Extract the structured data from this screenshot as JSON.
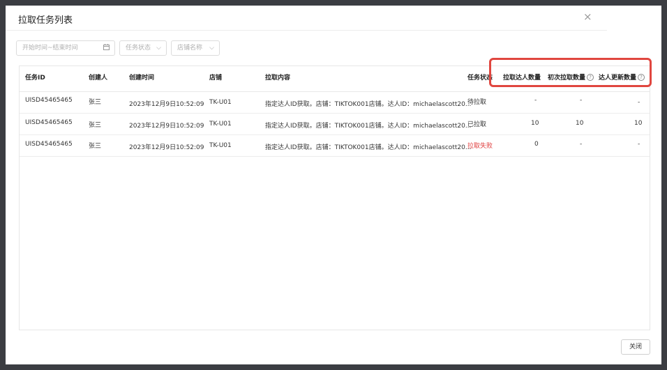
{
  "dialog": {
    "title": "拉取任务列表",
    "close_icon": "×"
  },
  "filters": {
    "date_range_placeholder": "开始时间~结束时间",
    "status_placeholder": "任务状态",
    "shop_placeholder": "店铺名称"
  },
  "columns": [
    "任务ID",
    "创建人",
    "创建时间",
    "店铺",
    "拉取内容",
    "任务状态",
    "拉取达人数量",
    "初次拉取数量",
    "达人更新数量"
  ],
  "rows": [
    {
      "task_id": "UISD45465465",
      "creator": "张三",
      "created_at": "2023年12月9日10:52:09",
      "shop": "TK-U01",
      "content": "指定达人ID获取。店铺：TIKTOK001店铺。达人ID：michaelascott20...",
      "status": "待拉取",
      "pulled": "-",
      "first_pull": "-",
      "updated": "-"
    },
    {
      "task_id": "UISD45465465",
      "creator": "张三",
      "created_at": "2023年12月9日10:52:09",
      "shop": "TK-U01",
      "content": "指定达人ID获取。店铺：TIKTOK001店铺。达人ID：michaelascott20...",
      "status": "已拉取",
      "pulled": "10",
      "first_pull": "10",
      "updated": "10"
    },
    {
      "task_id": "UISD45465465",
      "creator": "张三",
      "created_at": "2023年12月9日10:52:09",
      "shop": "TK-U01",
      "content": "指定达人ID获取。店铺：TIKTOK001店铺。达人ID：michaelascott20...",
      "status": "拉取失败",
      "pulled": "0",
      "first_pull": "-",
      "updated": "-"
    }
  ],
  "footer": {
    "close_label": "关闭"
  },
  "colors": {
    "fail_status": "#e04040",
    "highlight_border": "#e0463f"
  },
  "icons": {
    "calendar": "calendar-icon",
    "chevron": "chevron-down-icon",
    "help": "question-circle-icon"
  }
}
